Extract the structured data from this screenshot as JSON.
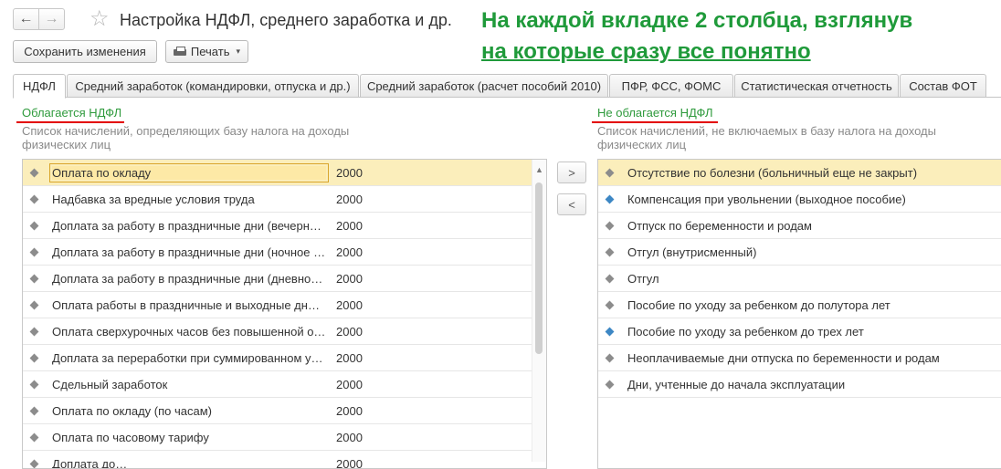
{
  "window": {
    "title": "Настройка НДФЛ, среднего заработка и др.",
    "nav_back_icon": "←",
    "nav_forward_icon": "→",
    "favorite_icon": "☆"
  },
  "annotation": {
    "line1": "На каждой вкладке 2 столбца, взглянув",
    "line2": "на которые сразу все понятно",
    "color": "#1f9a3a"
  },
  "toolbar": {
    "save_label": "Сохранить изменения",
    "print_label": "Печать",
    "print_caret": "▾"
  },
  "tabs": [
    {
      "label": "НДФЛ",
      "active": true
    },
    {
      "label": "Средний заработок (командировки, отпуска и др.)",
      "active": false
    },
    {
      "label": "Средний заработок (расчет пособий 2010)",
      "active": false
    },
    {
      "label": "ПФР, ФСС, ФОМС",
      "active": false
    },
    {
      "label": "Статистическая отчетность",
      "active": false
    },
    {
      "label": "Состав ФОТ",
      "active": false
    }
  ],
  "left_panel": {
    "title": "Облагается НДФЛ",
    "description": "Список начислений, определяющих базу налога на доходы физических лиц",
    "items": [
      {
        "name": "Оплата по окладу",
        "code": "2000",
        "selected": true,
        "icon": "gray-diamond-icon"
      },
      {
        "name": "Надбавка за вредные условия труда",
        "code": "2000",
        "icon": "gray-diamond-icon"
      },
      {
        "name": "Доплата за работу в праздничные дни (вечерне…",
        "code": "2000",
        "icon": "gray-diamond-icon"
      },
      {
        "name": "Доплата за работу в праздничные дни (ночное …",
        "code": "2000",
        "icon": "gray-diamond-icon"
      },
      {
        "name": "Доплата за работу в праздничные дни (дневное…",
        "code": "2000",
        "icon": "gray-diamond-icon"
      },
      {
        "name": "Оплата работы в праздничные и выходные дни …",
        "code": "2000",
        "icon": "gray-diamond-icon"
      },
      {
        "name": "Оплата сверхурочных часов без повышенной о…",
        "code": "2000",
        "icon": "gray-diamond-icon"
      },
      {
        "name": "Доплата за переработки при суммированном уч…",
        "code": "2000",
        "icon": "gray-diamond-icon"
      },
      {
        "name": "Сдельный заработок",
        "code": "2000",
        "icon": "gray-diamond-icon"
      },
      {
        "name": "Оплата по окладу (по часам)",
        "code": "2000",
        "icon": "gray-diamond-icon"
      },
      {
        "name": "Оплата по часовому тарифу",
        "code": "2000",
        "icon": "gray-diamond-icon"
      },
      {
        "name": "Доплата до…",
        "code": "2000",
        "icon": "gray-diamond-icon"
      }
    ]
  },
  "move_buttons": {
    "right_label": ">",
    "left_label": "<"
  },
  "right_panel": {
    "title": "Не облагается НДФЛ",
    "description": "Список начислений, не включаемых в базу налога на доходы физических лиц",
    "items": [
      {
        "name": "Отсутствие по болезни (больничный еще не закрыт)",
        "selected": true,
        "icon": "gray-diamond-icon"
      },
      {
        "name": "Компенсация при увольнении (выходное пособие)",
        "icon": "blue-diamond-icon"
      },
      {
        "name": "Отпуск по беременности и родам",
        "icon": "gray-diamond-icon"
      },
      {
        "name": "Отгул (внутрисменный)",
        "icon": "gray-diamond-icon"
      },
      {
        "name": "Отгул",
        "icon": "gray-diamond-icon"
      },
      {
        "name": "Пособие по уходу за ребенком до полутора лет",
        "icon": "gray-diamond-icon"
      },
      {
        "name": "Пособие по уходу за ребенком до трех лет",
        "icon": "blue-diamond-icon"
      },
      {
        "name": "Неоплачиваемые дни отпуска по беременности и родам",
        "icon": "gray-diamond-icon"
      },
      {
        "name": "Дни, учтенные до начала эксплуатации",
        "icon": "gray-diamond-icon"
      }
    ]
  },
  "colors": {
    "accent_green": "#2e9a3c",
    "underline_red": "#e30000",
    "selected_row": "#fbeebb"
  }
}
